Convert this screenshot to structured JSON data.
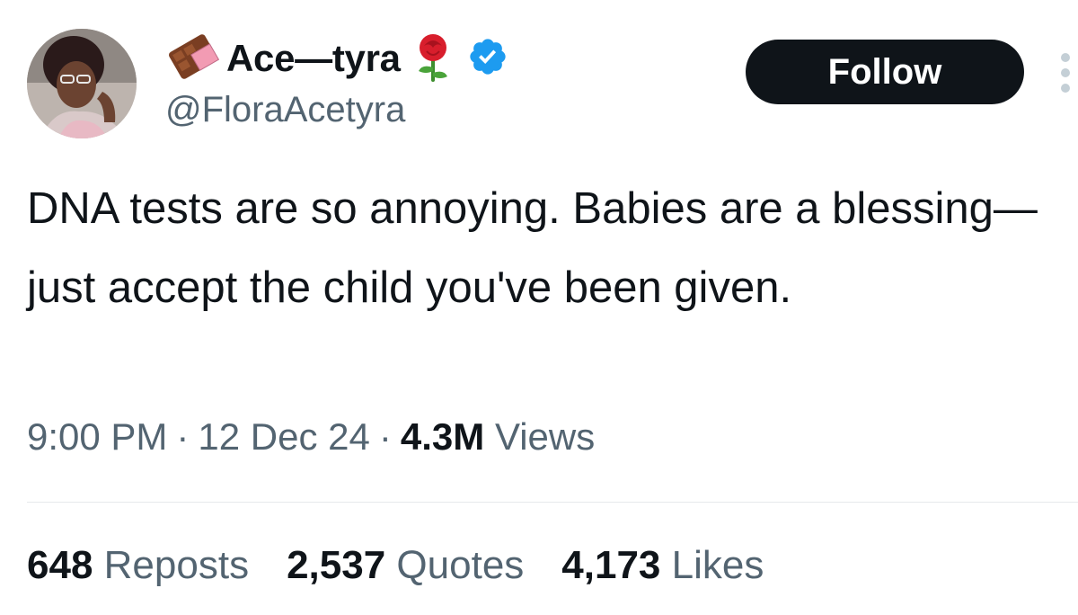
{
  "user": {
    "display_name": "Ace—tyra",
    "handle": "@FloraAcetyra",
    "name_prefix_icon": "chocolate-bar-icon",
    "name_suffix_icon": "rose-icon",
    "verified_icon": "verified-badge-icon",
    "verified_color": "#1d9bf0"
  },
  "actions": {
    "follow_label": "Follow",
    "more_icon": "more-options-icon"
  },
  "tweet": {
    "text": "DNA tests are so annoying. Babies are a blessing—just accept the child you've been given.",
    "time": "9:00 PM",
    "date": "12 Dec 24",
    "separator": "·",
    "views_count": "4.3M",
    "views_label": "Views"
  },
  "stats": {
    "reposts_count": "648",
    "reposts_label": "Reposts",
    "quotes_count": "2,537",
    "quotes_label": "Quotes",
    "likes_count": "4,173",
    "likes_label": "Likes"
  },
  "colors": {
    "text_primary": "#0f1419",
    "text_secondary": "#536471",
    "button_bg": "#0f1419",
    "divider": "#e6e9eb"
  }
}
